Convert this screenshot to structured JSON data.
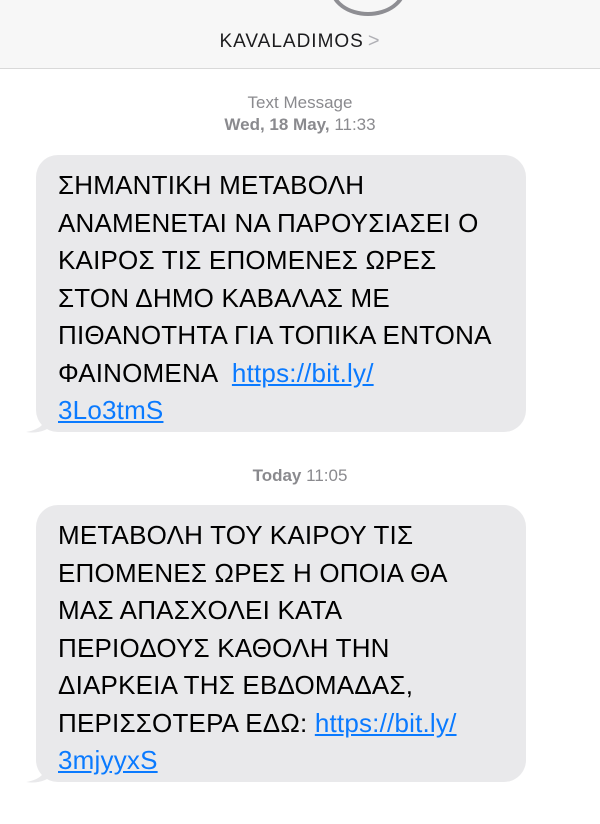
{
  "header": {
    "contact_name": "KAVALADIMOS",
    "chevron": ">"
  },
  "messages": [
    {
      "stamp_line1": "Text Message",
      "stamp_line2_bold": "Wed, 18 May,",
      "stamp_line2_time": "11:33",
      "body_lines": [
        "ΣΗΜΑΝΤΙΚΗ ΜΕΤΑΒΟΛΗ",
        "ΑΝΑΜΕΝΕΤΑΙ ΝΑ ΠΑΡΟΥΣΙΑΣΕΙ Ο",
        "ΚΑΙΡΟΣ ΤΙΣ ΕΠΟΜΕΝΕΣ ΩΡΕΣ",
        "ΣΤΟΝ ΔΗΜΟ ΚΑΒΑΛΑΣ ΜΕ",
        "ΠΙΘΑΝΟΤΗΤΑ ΓΙΑ ΤΟΠΙΚΑ ΕΝΤΟΝΑ"
      ],
      "last_line_prefix": "ΦΑΙΝΟΜΕΝΑ  ",
      "link_part1": "https://bit.ly/",
      "link_part2": "3Lo3tmS"
    },
    {
      "stamp_bold": "Today",
      "stamp_time": "11:05",
      "body_lines": [
        "ΜΕΤΑΒΟΛΗ ΤΟΥ ΚΑΙΡΟΥ ΤΙΣ",
        "ΕΠΟΜΕΝΕΣ ΩΡΕΣ Η ΟΠΟΙΑ ΘΑ",
        "ΜΑΣ ΑΠΑΣΧΟΛΕΙ ΚΑΤΑ",
        "ΠΕΡΙΟΔΟΥΣ ΚΑΘΟΛΗ ΤΗΝ",
        "ΔΙΑΡΚΕΙΑ ΤΗΣ ΕΒΔΟΜΑΔΑΣ,"
      ],
      "last_line_prefix": "ΠΕΡΙΣΣΟΤΕΡΑ ΕΔΩ: ",
      "link_part1": "https://bit.ly/",
      "link_part2": "3mjyyxS"
    }
  ],
  "colors": {
    "bubble": "#e9e9eb",
    "link": "#0a7aff",
    "stamp": "#8a8a8e"
  }
}
